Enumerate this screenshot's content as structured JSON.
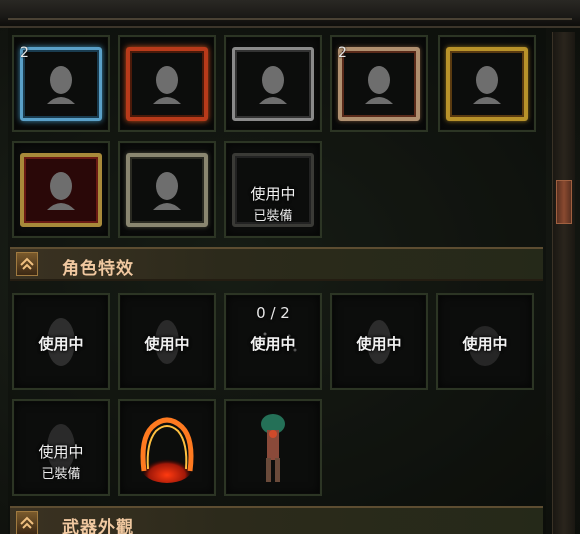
{
  "portrait_frames": {
    "row1": [
      {
        "count": "2",
        "style": "ice"
      },
      {
        "count": "",
        "style": "lava"
      },
      {
        "count": "",
        "style": "plain"
      },
      {
        "count": "2",
        "style": "bone"
      },
      {
        "count": "",
        "style": "gold"
      }
    ],
    "row2": [
      {
        "count": "",
        "style": "ornate-red"
      },
      {
        "count": "",
        "style": "skull"
      },
      {
        "status": "使用中",
        "equipped": "已裝備",
        "style": "dark"
      }
    ]
  },
  "sections": {
    "character_effects": "角色特效",
    "weapon_skins": "武器外觀"
  },
  "character_effects": {
    "row1": [
      {
        "status": "使用中"
      },
      {
        "status": "使用中"
      },
      {
        "status": "使用中",
        "progress": "0 / 2"
      },
      {
        "status": "使用中"
      },
      {
        "status": "使用中"
      }
    ],
    "row2": [
      {
        "status": "使用中",
        "equipped": "已裝備"
      },
      {
        "effect": "fire-ring"
      },
      {
        "effect": "green-aura"
      }
    ]
  },
  "colors": {
    "accent": "#f0c8a0",
    "tile_border": "#2c3524",
    "scroll_thumb": "#8a4a30"
  }
}
